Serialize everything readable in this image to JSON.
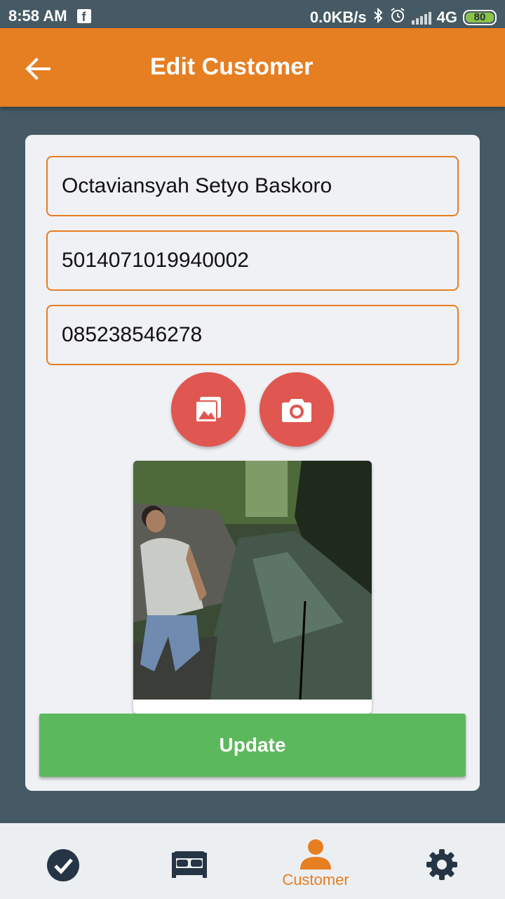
{
  "status_bar": {
    "time": "8:58 AM",
    "network_speed": "0.0KB/s",
    "network_type": "4G",
    "battery": "80",
    "icons": [
      "facebook-icon",
      "bluetooth-icon",
      "alarm-icon",
      "signal-icon",
      "battery-icon"
    ]
  },
  "app_bar": {
    "title": "Edit Customer",
    "back_icon": "arrow-left-icon"
  },
  "form": {
    "name_value": "Octaviansyah Setyo Baskoro",
    "id_number_value": "5014071019940002",
    "phone_value": "085238546278",
    "gallery_icon": "gallery-icon",
    "camera_icon": "camera-icon",
    "update_label": "Update"
  },
  "bottom_nav": {
    "items": [
      {
        "icon": "check-circle-icon",
        "label": ""
      },
      {
        "icon": "bed-icon",
        "label": ""
      },
      {
        "icon": "person-icon",
        "label": "Customer"
      },
      {
        "icon": "gear-icon",
        "label": ""
      }
    ],
    "active_index": 2
  },
  "colors": {
    "primary": "#e67e22",
    "background": "#455a64",
    "action": "#e05650",
    "update": "#5cb85c",
    "dark_icon": "#263545"
  }
}
